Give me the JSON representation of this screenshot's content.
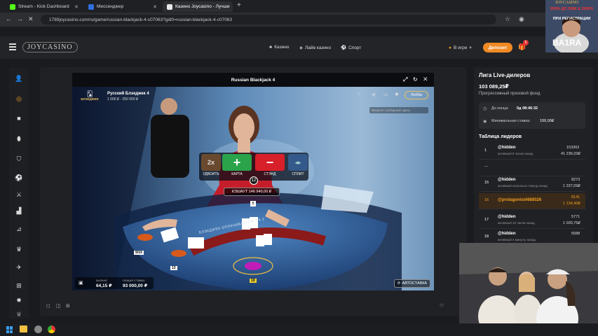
{
  "browser": {
    "tabs": [
      {
        "label": "Stream - Kick Dashboard",
        "color": "#53fc18",
        "active": false
      },
      {
        "label": "Мессенджер",
        "color": "#2f6fe0",
        "active": false
      },
      {
        "label": "Казино Joycasino - Лучши",
        "color": "#e8e8e8",
        "active": true
      }
    ],
    "new_tab": "+",
    "url": "1789joycasino.com/ru/game/russian-blackjack-4-c07063?gid0=russian-blackjack-4-c07063"
  },
  "site": {
    "logo": "JOYCASINO",
    "nav": [
      "Казино",
      "Лайв казино",
      "Спорт"
    ],
    "status": "В игре",
    "deposit": "Депозит",
    "notif_count": "5"
  },
  "game": {
    "title": "Russian Blackjack 4",
    "table_name": "Русский Блэкджек 4",
    "limits": "1 000 ₽ - 250 000 ₽",
    "brand_badge": "БЛЭКДЖЕК",
    "lobby": "Лобби",
    "chat_hint": "Введите сообщение здесь",
    "buttons": {
      "double": "УДВОИТЬ",
      "double_icon": "2x",
      "hit": "КАРТА",
      "stand": "СТЭНД",
      "split": "СПЛИТ"
    },
    "timer": "12",
    "jackpot": "КЭШАУТ 146 940,00 ₽",
    "dealer_score": "8",
    "table_text": "БЛЭКДЖЕК ОПЛАЧИВАЕТСЯ 3 К 2",
    "hand_score_left": "9/19",
    "hand_score_mid": "13",
    "hand_score_main": "19",
    "balance_label": "БАЛАНС",
    "balance": "64,15 ₽",
    "total_bet_label": "ОБЩАЯ СТАВКА",
    "total_bet": "93 000,00 ₽",
    "autostake": "АВТОСТАВКА"
  },
  "rightpanel": {
    "league_title": "Лига Live-дилеров",
    "prize_amount": "103 089,25₽",
    "prize_label": "Прогрессивный призовой фонд",
    "until_end_label": "До конца:",
    "until_end_value": "0д 08:46:32",
    "min_bet_label": "Минимальная ставка:",
    "min_bet_value": "100,00₽",
    "leaderboard_title": "Таблица лидеров",
    "leaders": [
      {
        "rank": "1",
        "name": "@hidden",
        "time": "активный 8 часов назад",
        "score": "153362",
        "prize": "41 236,03₽",
        "hl": false
      },
      {
        "rank": "...",
        "name": "",
        "time": "",
        "score": "",
        "prize": "",
        "hl": false
      },
      {
        "rank": "15",
        "name": "@hidden",
        "time": "активный несколько секунд назад",
        "score": "8273",
        "prize": "1 237,09₽",
        "hl": false
      },
      {
        "rank": "16",
        "name": "@protagonist#888526",
        "time": "",
        "score": "8141",
        "prize": "1 134,40₽",
        "hl": true
      },
      {
        "rank": "17",
        "name": "@hidden",
        "time": "активный 10 часов назад",
        "score": "5771",
        "prize": "1 030,75₽",
        "hl": false
      },
      {
        "rank": "18",
        "name": "@hidden",
        "time": "активный 4 минуты назад",
        "score": "5588",
        "prize": "",
        "hl": false
      }
    ]
  },
  "overlay": {
    "streamer_name": "BA1RA",
    "promo_line1": "JOYCASINO",
    "promo_line2": "200% ДО 200К & 200FS",
    "promo_line3": "ПРИ РЕГИСТРАЦИИ"
  }
}
